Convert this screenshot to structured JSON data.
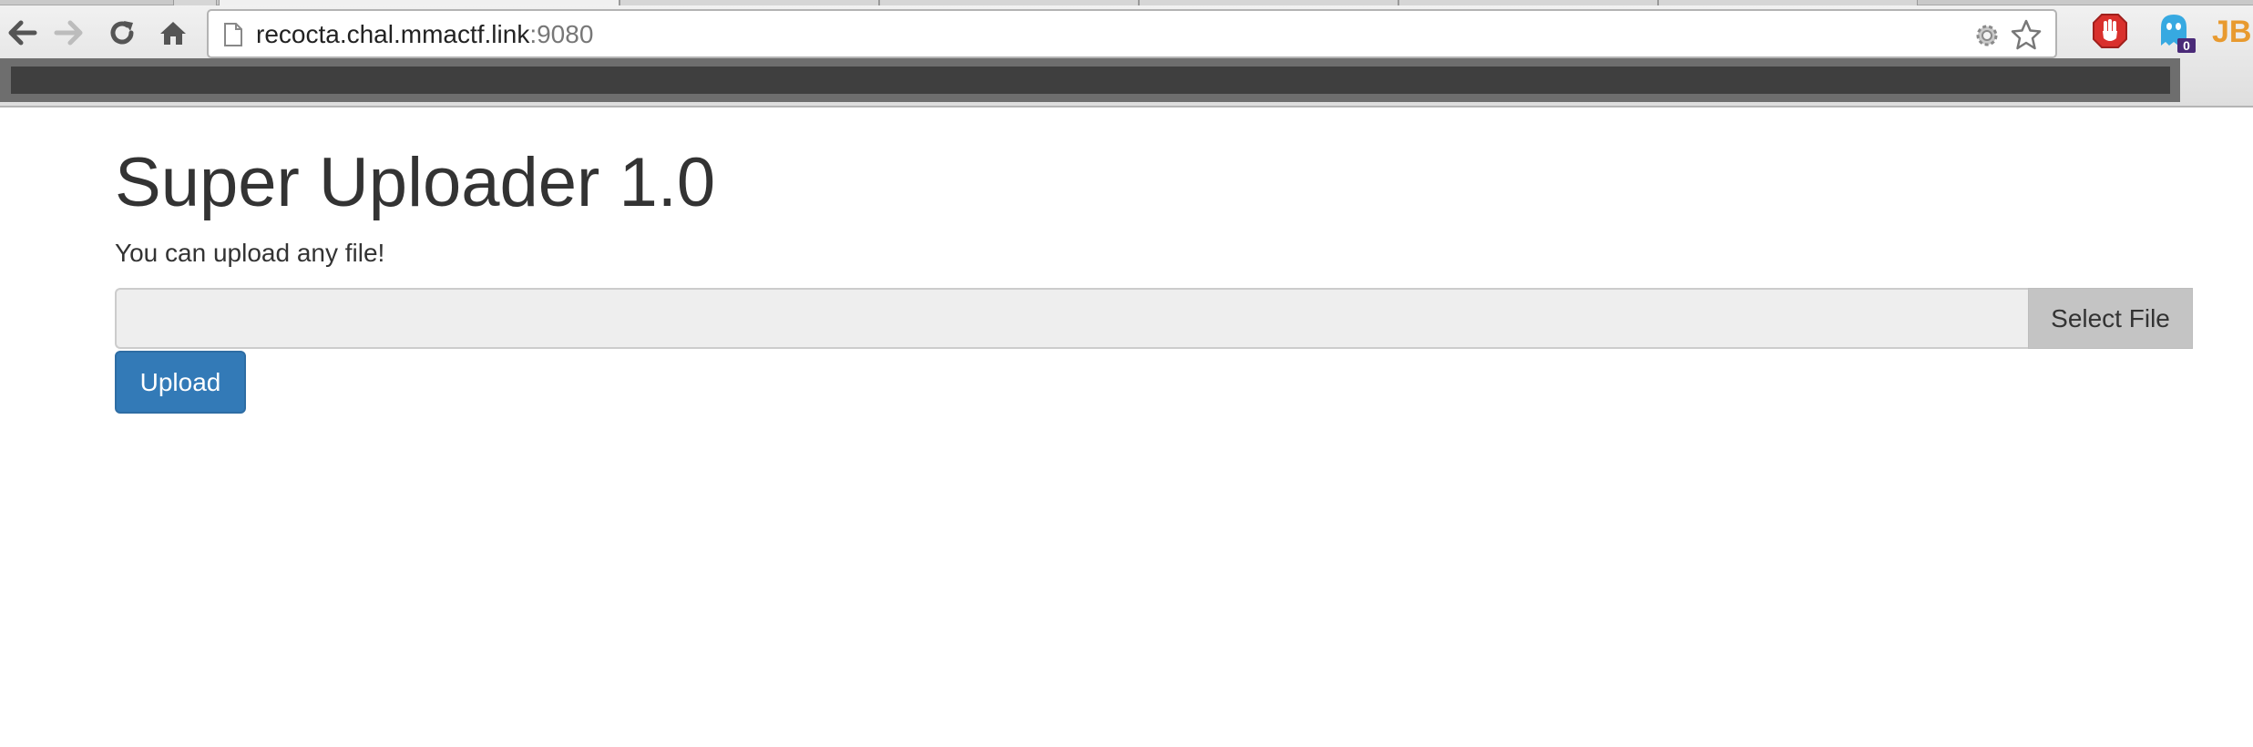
{
  "browser": {
    "url_host": "recocta.chal.mmactf.link",
    "url_port": ":9080",
    "nav_icons": [
      "back-arrow-icon",
      "forward-arrow-icon",
      "reload-icon",
      "home-icon"
    ],
    "omnibox_icons": [
      "page-icon",
      "gear-icon",
      "bookmark-star-icon"
    ],
    "extensions": [
      {
        "icon": "adblock-hand-icon",
        "color": "#d9302c"
      },
      {
        "icon": "ghostery-icon",
        "color": "#37a9e1",
        "badge": "0"
      },
      {
        "icon": "jetbrains-icon",
        "text": "JB",
        "color": "#2d7bd4"
      }
    ]
  },
  "page": {
    "title": "Super Uploader 1.0",
    "subtitle": "You can upload any file!",
    "file_input": {
      "value": "",
      "placeholder": ""
    },
    "select_file_label": "Select File",
    "upload_label": "Upload"
  },
  "colors": {
    "primary_button": "#337ab7",
    "text": "#333333",
    "input_bg": "#eeeeee",
    "select_btn_bg": "#c4c4c4"
  }
}
